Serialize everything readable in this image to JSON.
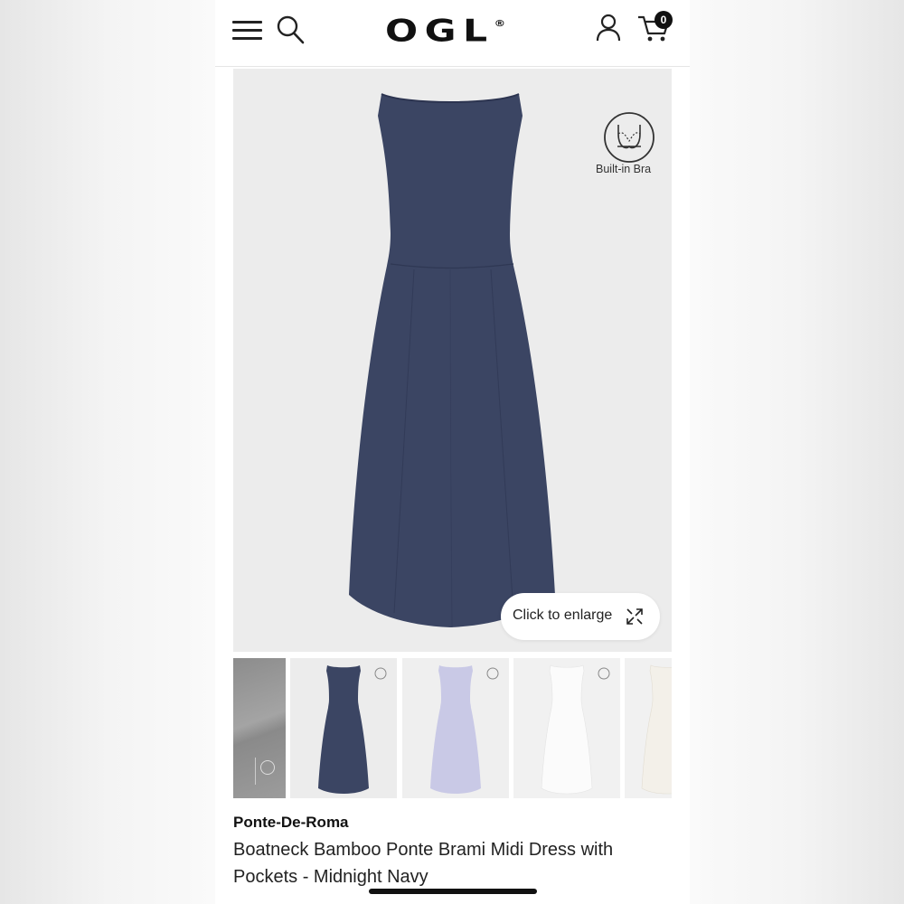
{
  "header": {
    "logo": "OGL",
    "logo_mark": "®",
    "cart_count": "0",
    "icons": [
      "hamburger-menu-icon",
      "search-icon",
      "account-icon",
      "cart-icon"
    ]
  },
  "hero": {
    "badge_label": "Built-in Bra",
    "enlarge_label": "Click to enlarge",
    "dress_color": "#3b4563"
  },
  "thumbnails": [
    {
      "label": "swatch-gray",
      "color": "#9a9a9a"
    },
    {
      "label": "midnight-navy",
      "color": "#3b4563"
    },
    {
      "label": "lavender",
      "color": "#c9c9e6"
    },
    {
      "label": "white",
      "color": "#fafafa"
    },
    {
      "label": "ivory",
      "color": "#f1eee7"
    }
  ],
  "product": {
    "brand": "Ponte-De-Roma",
    "title": "Boatneck Bamboo Ponte Brami Midi Dress with Pockets - Midnight Navy"
  }
}
